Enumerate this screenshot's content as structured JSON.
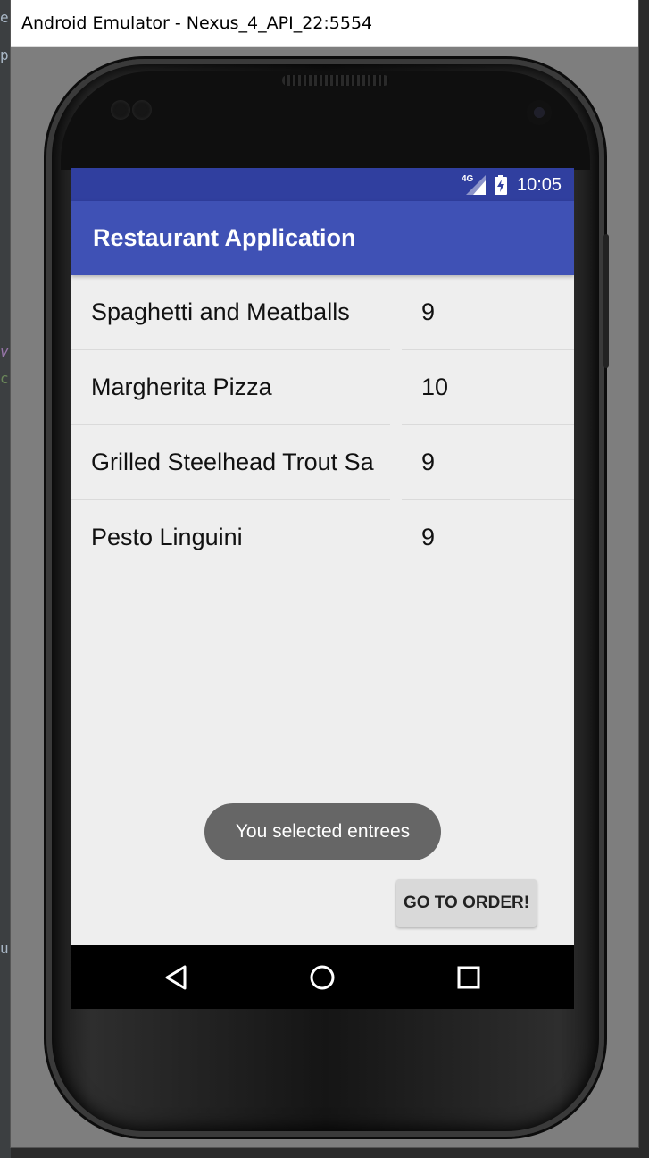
{
  "window": {
    "title": "Android Emulator - Nexus_4_API_22:5554"
  },
  "background_ide": {
    "fragments": [
      "e",
      "p",
      "v",
      "c",
      "u"
    ]
  },
  "status_bar": {
    "network": "4G",
    "time": "10:05",
    "color": "#303f9f"
  },
  "app_bar": {
    "title": "Restaurant Application",
    "color": "#3f51b5"
  },
  "menu": {
    "items": [
      {
        "name": "Spaghetti and Meatballs",
        "price": "9"
      },
      {
        "name": "Margherita Pizza",
        "price": "10"
      },
      {
        "name": "Grilled Steelhead Trout Sa",
        "price": "9"
      },
      {
        "name": "Pesto Linguini",
        "price": "9"
      }
    ]
  },
  "toast": {
    "message": "You selected entrees"
  },
  "order_button": {
    "label": "GO TO ORDER!"
  },
  "nav_bar": {
    "icons": [
      "back-icon",
      "home-icon",
      "recents-icon"
    ]
  }
}
